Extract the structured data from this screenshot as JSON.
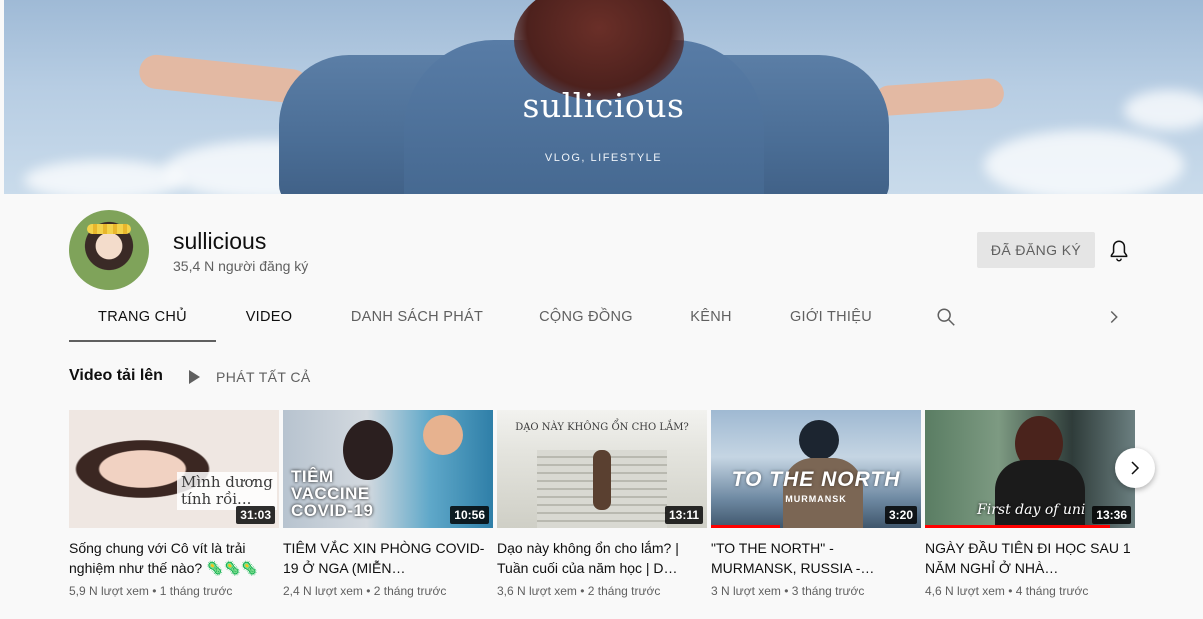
{
  "banner": {
    "title": "sullicious",
    "subtitle": "VLOG, LIFESTYLE"
  },
  "channel": {
    "name": "sullicious",
    "subscribers": "35,4 N người đăng ký",
    "subscribe_label": "ĐÃ ĐĂNG KÝ"
  },
  "tabs": [
    {
      "label": "TRANG CHỦ"
    },
    {
      "label": "VIDEO"
    },
    {
      "label": "DANH SÁCH PHÁT"
    },
    {
      "label": "CỘNG ĐỒNG"
    },
    {
      "label": "KÊNH"
    },
    {
      "label": "GIỚI THIỆU"
    }
  ],
  "section": {
    "title": "Video tải lên",
    "play_all": "PHÁT TẤT CẢ"
  },
  "videos": [
    {
      "title": "Sống chung với Cô vít là trải nghiệm như thế nào? 🦠🦠🦠",
      "duration": "31:03",
      "meta": "5,9 N lượt xem • 1 tháng trước",
      "thumb_text": "Mình dương tính rồi...",
      "watched": 0
    },
    {
      "title": "TIÊM VẮC XIN PHÒNG COVID-19 Ở NGA (MIỄN…",
      "duration": "10:56",
      "meta": "2,4 N lượt xem • 2 tháng trước",
      "thumb_text": "TIÊM VACCINE COVID-19",
      "watched": 0
    },
    {
      "title": "Dạo này không ổn cho lắm? | Tuần cuối của năm học | D…",
      "duration": "13:11",
      "meta": "3,6 N lượt xem • 2 tháng trước",
      "thumb_text": "DẠO NÀY KHÔNG ỔN CHO LẮM?",
      "watched": 0
    },
    {
      "title": "\"TO THE NORTH\" - MURMANSK, RUSSIA -…",
      "duration": "3:20",
      "meta": "3 N lượt xem • 3 tháng trước",
      "thumb_text": "TO THE NORTH",
      "thumb_sub": "MURMANSK",
      "watched": 0.33
    },
    {
      "title": "NGÀY ĐẦU TIÊN ĐI HỌC SAU 1 NĂM NGHỈ Ở NHÀ…",
      "duration": "13:36",
      "meta": "4,6 N lượt xem • 4 tháng trước",
      "thumb_text": "First day of uni",
      "watched": 0.88
    }
  ],
  "colors": {
    "progress": "#ff0000",
    "tab_active_underline": "#606060"
  }
}
